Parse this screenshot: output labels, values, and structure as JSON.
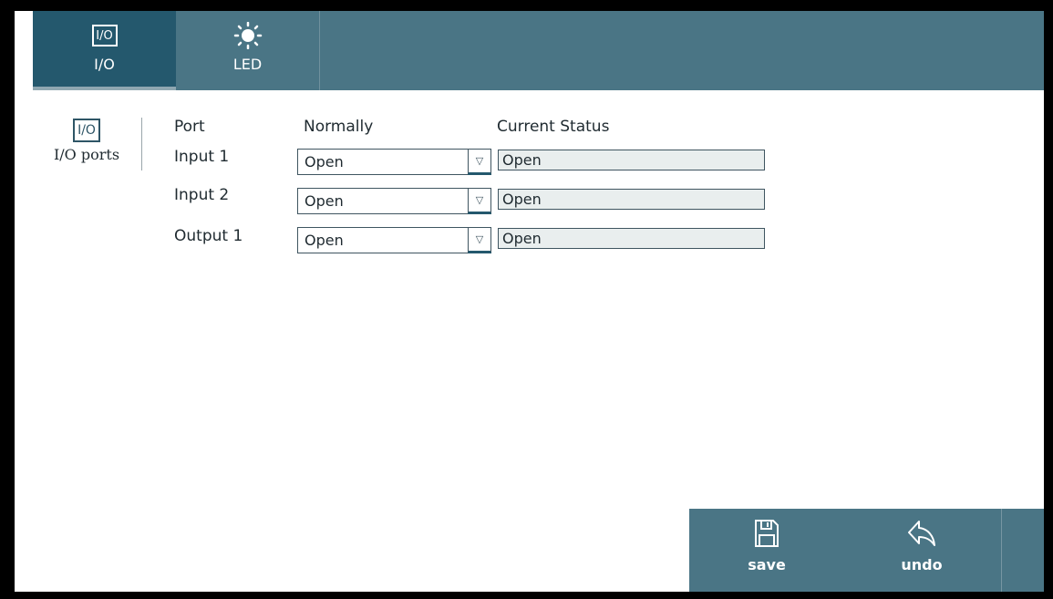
{
  "tabs": [
    {
      "label": "I/O",
      "icon": "io-icon",
      "active": true
    },
    {
      "label": "LED",
      "icon": "sun-icon",
      "active": false
    }
  ],
  "category": {
    "icon_text": "I/O",
    "label": "I/O ports"
  },
  "table": {
    "headers": {
      "port": "Port",
      "normally": "Normally",
      "status": "Current Status"
    },
    "rows": [
      {
        "port": "Input 1",
        "normally": "Open",
        "status": "Open"
      },
      {
        "port": "Input 2",
        "normally": "Open",
        "status": "Open"
      },
      {
        "port": "Output 1",
        "normally": "Open",
        "status": "Open"
      }
    ]
  },
  "actions": {
    "save": "save",
    "undo": "undo"
  },
  "colors": {
    "bar": "#4a7585",
    "active_tab": "#24586d"
  }
}
